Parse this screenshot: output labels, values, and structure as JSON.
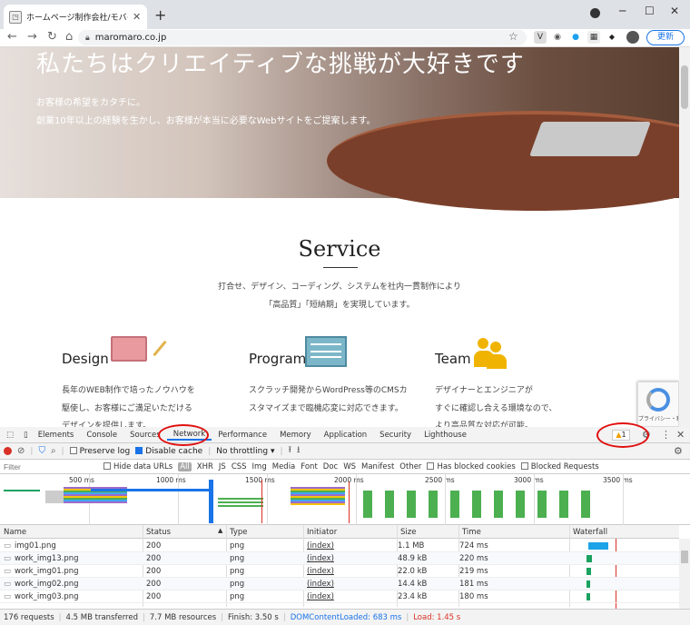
{
  "browser": {
    "tab_title": "ホームページ制作会社/モバイルコンテ",
    "url": "maromaro.co.jp",
    "update_label": "更新"
  },
  "hero": {
    "title": "私たちはクリエイティブな挑戦が大好きです",
    "line1": "お客様の希望をカタチに。",
    "line2": "創業10年以上の経験を生かし、お客様が本当に必要なWebサイトをご提案します。"
  },
  "service": {
    "title": "Service",
    "line1": "打合せ、デザイン、コーディング、システムを社内一貫制作により",
    "line2": "「高品質」「短納期」を実現しています。",
    "columns": [
      {
        "heading": "Design",
        "lines": [
          "長年のWEB制作で培ったノウハウを",
          "駆使し、お客様にご満足いただける",
          "デザインを提供します。"
        ]
      },
      {
        "heading": "Program",
        "lines": [
          "スクラッチ開発からWordPress等のCMSカ",
          "スタマイズまで臨機応変に対応できます。"
        ]
      },
      {
        "heading": "Team",
        "lines": [
          "デザイナーとエンジニアが",
          "すぐに確認し合える環境なので、",
          "より高品質な対応が可能。"
        ]
      }
    ],
    "recaptcha_text": "プライバシー・利用規約"
  },
  "devtools": {
    "tabs": [
      "Elements",
      "Console",
      "Sources",
      "Network",
      "Performance",
      "Memory",
      "Application",
      "Security",
      "Lighthouse"
    ],
    "active_tab": "Network",
    "warning_count": "1",
    "preserve_log": "Preserve log",
    "disable_cache": "Disable cache",
    "throttling": "No throttling",
    "filter_placeholder": "Filter",
    "hide_data_urls": "Hide data URLs",
    "filter_types": [
      "All",
      "XHR",
      "JS",
      "CSS",
      "Img",
      "Media",
      "Font",
      "Doc",
      "WS",
      "Manifest",
      "Other"
    ],
    "has_blocked_cookies": "Has blocked cookies",
    "blocked_requests": "Blocked Requests",
    "timeline_ticks": [
      "500 ms",
      "1000 ms",
      "1500 ms",
      "2000 ms",
      "2500 ms",
      "3000 ms",
      "3500 ms"
    ],
    "columns": [
      "Name",
      "Status",
      "Type",
      "Initiator",
      "Size",
      "Time",
      "Waterfall"
    ],
    "rows": [
      {
        "name": "img01.png",
        "status": "200",
        "type": "png",
        "initiator": "(index)",
        "size": "1.1 MB",
        "time": "724 ms"
      },
      {
        "name": "work_img13.png",
        "status": "200",
        "type": "png",
        "initiator": "(index)",
        "size": "48.9 kB",
        "time": "220 ms"
      },
      {
        "name": "work_img01.png",
        "status": "200",
        "type": "png",
        "initiator": "(index)",
        "size": "22.0 kB",
        "time": "219 ms"
      },
      {
        "name": "work_img02.png",
        "status": "200",
        "type": "png",
        "initiator": "(index)",
        "size": "14.4 kB",
        "time": "181 ms"
      },
      {
        "name": "work_img03.png",
        "status": "200",
        "type": "png",
        "initiator": "(index)",
        "size": "23.4 kB",
        "time": "180 ms"
      }
    ],
    "status_bar": {
      "requests": "176 requests",
      "transferred": "4.5 MB transferred",
      "resources": "7.7 MB resources",
      "finish": "Finish: 3.50 s",
      "dom": "DOMContentLoaded: 683 ms",
      "load": "Load: 1.45 s"
    }
  },
  "colors": {
    "dom_blue": "#1a73e8",
    "load_red": "#d93025",
    "annotation": "#e01010"
  }
}
